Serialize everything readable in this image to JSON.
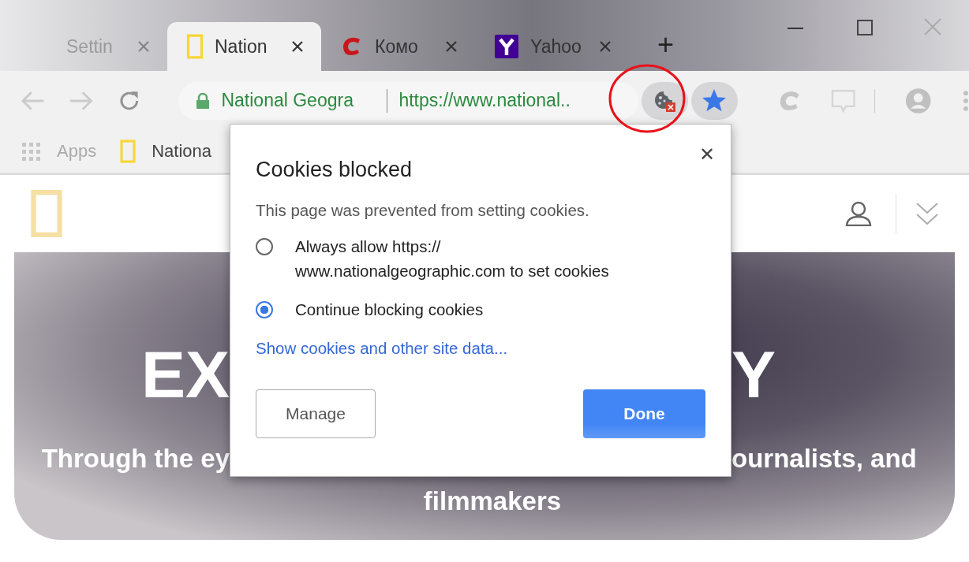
{
  "tabs": [
    {
      "label": "Settin",
      "kind": "plain",
      "selected": false
    },
    {
      "label": "Nation",
      "kind": "natgeo",
      "selected": true
    },
    {
      "label": "Комо",
      "kind": "comodo",
      "selected": false
    },
    {
      "label": "Yahoo",
      "kind": "yahoo",
      "selected": false
    }
  ],
  "new_tab": "+",
  "toolbar": {
    "site_name": "National Geogra",
    "url": "https://www.national..",
    "cookies_blocked": true,
    "bookmarked": true
  },
  "bookmarks": [
    {
      "kind": "apps",
      "label": "Apps"
    },
    {
      "kind": "natgeo",
      "label": "Nationa"
    }
  ],
  "hero": {
    "headline_left": "EX",
    "headline_right": "Y",
    "subtitle_left": "Through the ey",
    "subtitle_right": "ournalists, and",
    "subtitle_last": "filmmakers"
  },
  "dialog": {
    "title": "Cookies blocked",
    "close": "✕",
    "message": "This page was prevented from setting cookies.",
    "options": [
      {
        "label": "Always allow https://\nwww.nationalgeographic.com to set cookies",
        "selected": false
      },
      {
        "label": "Continue blocking cookies",
        "selected": true
      }
    ],
    "link": "Show cookies and other site data...",
    "buttons": [
      {
        "label": "Manage",
        "kind": "secondary"
      },
      {
        "label": "Done",
        "kind": "primary"
      }
    ]
  }
}
